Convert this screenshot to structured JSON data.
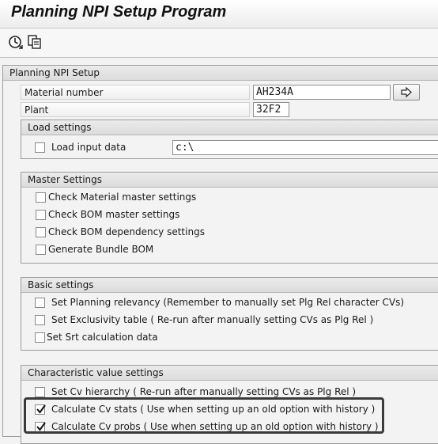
{
  "window": {
    "title": "Planning NPI Setup Program"
  },
  "toolbar": {
    "icons": [
      "execute-icon",
      "copy-variant-icon"
    ]
  },
  "colors": {
    "highlight": "#3a3a3a",
    "background": "#f3f3f3"
  },
  "setup": {
    "header": "Planning NPI Setup",
    "material_label": "Material number",
    "material_value": "AH234A",
    "plant_label": "Plant",
    "plant_value": "32F2"
  },
  "load": {
    "header": "Load settings",
    "load_input_label": "Load input data",
    "load_input_checked": false,
    "path_value": "c:\\"
  },
  "master": {
    "header": "Master Settings",
    "items": [
      {
        "label": "Check Material master settings",
        "checked": false
      },
      {
        "label": "Check BOM master settings",
        "checked": false
      },
      {
        "label": "Check BOM dependency settings",
        "checked": false
      },
      {
        "label": "Generate Bundle BOM",
        "checked": false
      }
    ]
  },
  "basic": {
    "header": "Basic settings",
    "items": [
      {
        "label": "Set Planning relevancy (Remember to manually set Plg Rel character CVs)",
        "checked": false
      },
      {
        "label": "Set Exclusivity table ( Re-run after manually setting CVs as Plg Rel )",
        "checked": false
      },
      {
        "label": "Set Srt calculation data",
        "checked": false
      }
    ]
  },
  "cv": {
    "header": "Characteristic value settings",
    "items": [
      {
        "label": "Set Cv hierarchy ( Re-run after manually setting CVs as Plg Rel )",
        "checked": false
      },
      {
        "label": "Calculate Cv stats ( Use when setting up an old option with history )",
        "checked": true
      },
      {
        "label": "Calculate Cv probs ( Use when setting up an old option with history )",
        "checked": true
      }
    ]
  }
}
